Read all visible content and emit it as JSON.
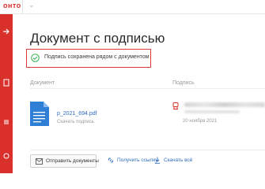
{
  "topbar": {
    "brand_fragment": "онто",
    "chevron": "⌄"
  },
  "page": {
    "title": "Документ с подписью"
  },
  "notice": {
    "message": "Подпись сохранена рядом с документом"
  },
  "columns": {
    "document_label": "Документ",
    "signature_label": "Подпись"
  },
  "document": {
    "file_name": "p_2021_694.pdf",
    "download_label": "Скачать подпись"
  },
  "signature": {
    "date": "20 ноября 2021"
  },
  "actions": {
    "send_label": "Отправить документы",
    "link_label": "Получить ссылку",
    "download_all_label": "Скачать всё"
  },
  "colors": {
    "accent": "#d9302c",
    "success": "#2fae4a",
    "link": "#2d6cc0",
    "file_icon": "#2f7fd6"
  }
}
